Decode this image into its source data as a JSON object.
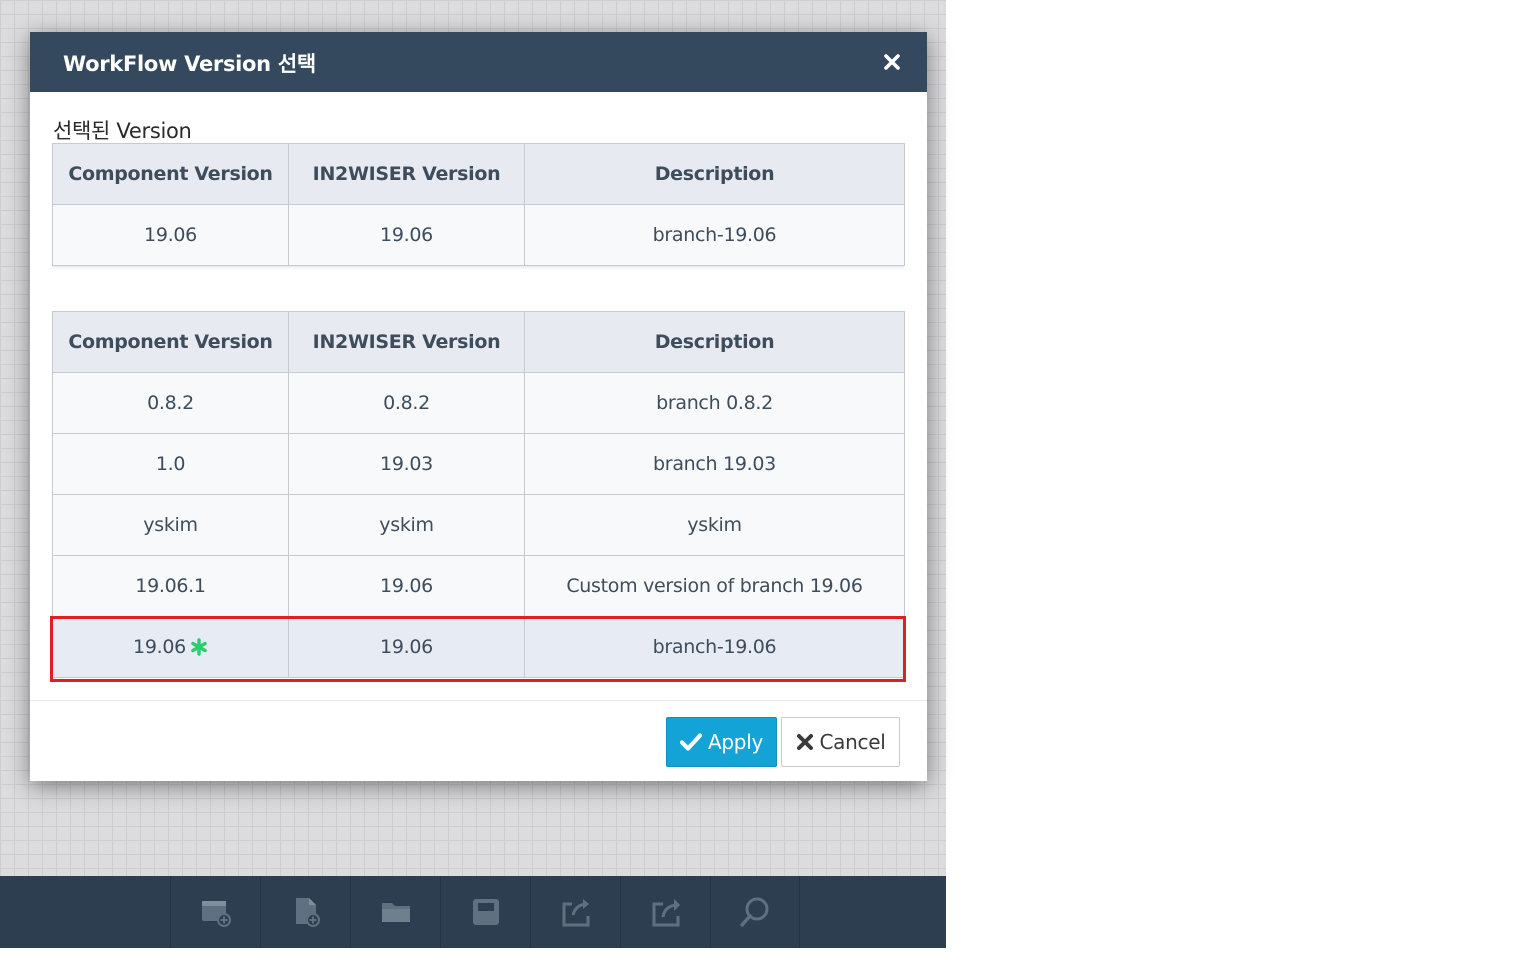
{
  "modal": {
    "title": "WorkFlow Version 선택",
    "close_icon": "close-icon",
    "selected_label": "선택된 Version"
  },
  "selected_table": {
    "headers": [
      "Component Version",
      "IN2WISER Version",
      "Description"
    ],
    "rows": [
      [
        "19.06",
        "19.06",
        "branch-19.06"
      ]
    ]
  },
  "version_table": {
    "headers": [
      "Component Version",
      "IN2WISER Version",
      "Description"
    ],
    "rows": [
      [
        "0.8.2",
        "0.8.2",
        "branch 0.8.2"
      ],
      [
        "1.0",
        "19.03",
        "branch 19.03"
      ],
      [
        "yskim",
        "yskim",
        "yskim"
      ],
      [
        "19.06.1",
        "19.06",
        "Custom version of branch 19.06"
      ],
      [
        "19.06",
        "19.06",
        "branch-19.06"
      ]
    ],
    "selected_row_index": 4,
    "current_marker_icon": "asterisk-icon",
    "current_marker_color": "#2ecc71",
    "highlight_color": "#e01e26"
  },
  "buttons": {
    "apply_label": "Apply",
    "apply_icon": "check-icon",
    "cancel_label": "Cancel",
    "cancel_icon": "x-icon"
  },
  "toolbar": {
    "items": [
      {
        "icon": "new-window-icon"
      },
      {
        "icon": "new-file-icon"
      },
      {
        "icon": "folder-icon"
      },
      {
        "icon": "save-icon"
      },
      {
        "icon": "import-icon"
      },
      {
        "icon": "export-icon"
      },
      {
        "icon": "search-icon"
      }
    ]
  },
  "colors": {
    "header_bg": "#34495e",
    "toolbar_bg": "#2d3e50",
    "apply_bg": "#14a3d7"
  }
}
